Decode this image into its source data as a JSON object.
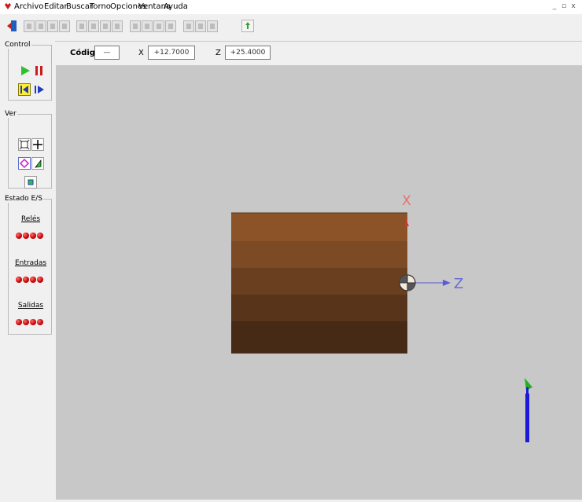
{
  "menubar": {
    "items": [
      "Archivo",
      "Editar",
      "Buscar",
      "Torno",
      "Opciones",
      "Ventana",
      "Ayuda"
    ],
    "window_controls": [
      "_",
      "&#8482;",
      "x"
    ]
  },
  "coords": {
    "codigo_label": "Código",
    "codigo_value": "—",
    "x_label": "X",
    "x_value": "+12.7000",
    "z_label": "Z",
    "z_value": "+25.4000"
  },
  "sidebar": {
    "control_title": "Control",
    "ver_title": "Ver",
    "estado_title": "Estado E/S",
    "reles_label": "Relés",
    "entradas_label": "Entradas",
    "salidas_label": "Salidas"
  },
  "scene": {
    "axis_x_label": "X",
    "axis_z_label": "Z",
    "workpiece_colors": [
      "#8c5328",
      "#7c4a24",
      "#6a3f1f",
      "#58351a",
      "#472a15"
    ]
  }
}
